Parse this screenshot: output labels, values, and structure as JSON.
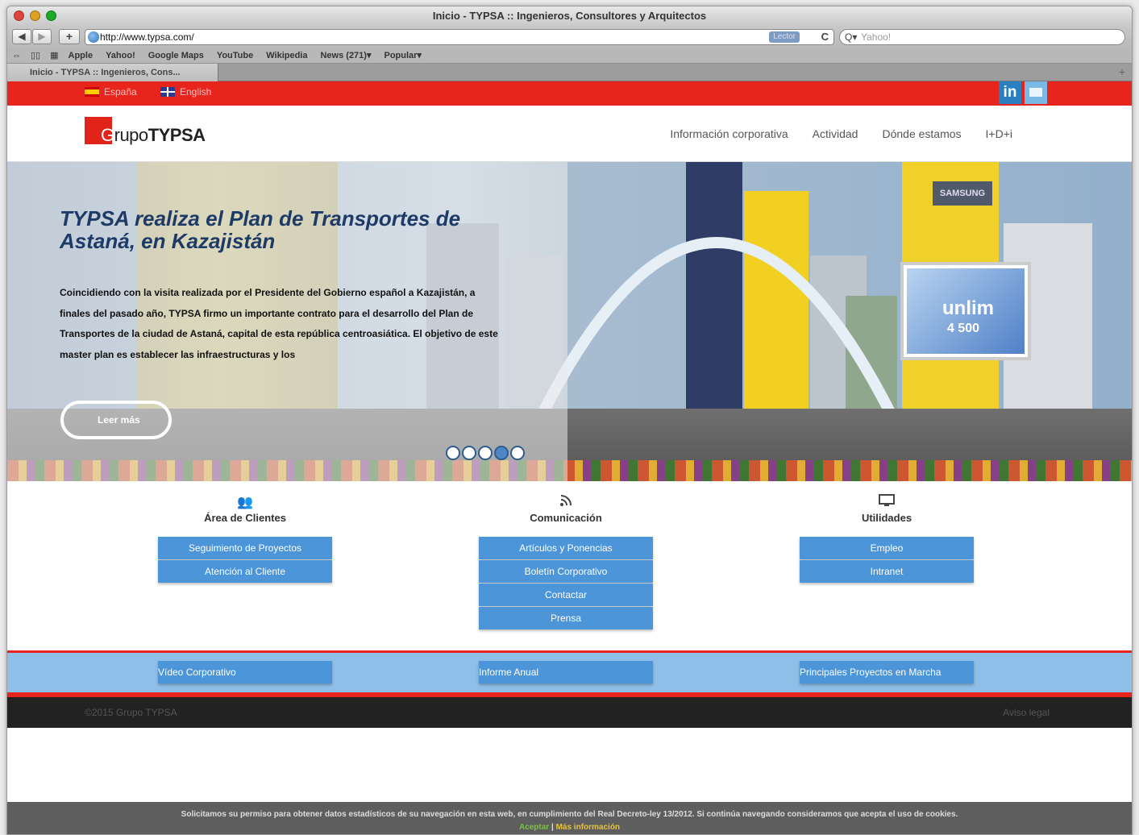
{
  "browser": {
    "window_title": "Inicio - TYPSA :: Ingenieros, Consultores y Arquitectos",
    "url": "http://www.typsa.com/",
    "reader_label": "Lector",
    "search_placeholder": "Yahoo!",
    "bookmarks": [
      "Apple",
      "Yahoo!",
      "Google Maps",
      "YouTube",
      "Wikipedia",
      "News (271)▾",
      "Popular▾"
    ],
    "tab_title": "Inicio - TYPSA :: Ingenieros, Cons..."
  },
  "topbar": {
    "lang_es": "España",
    "lang_en": "English",
    "linkedin_label": "in"
  },
  "header": {
    "logo_prefix": "G",
    "logo_grupo": "rupo",
    "logo_typsa": "TYPSA",
    "nav": [
      "Información corporativa",
      "Actividad",
      "Dónde estamos",
      "I+D+i"
    ]
  },
  "hero": {
    "title": "TYPSA realiza el Plan de Transportes de Astaná, en Kazajistán",
    "text": "Coincidiendo con la visita realizada por el Presidente del Gobierno español a Kazajistán, a finales del pasado año, TYPSA firmo un importante contrato para el desarrollo del Plan de Transportes de la ciudad de Astaná, capital de esta república centroasiática. El objetivo de este master plan  es establecer las infraestructuras y los",
    "read_more": "Leer más",
    "billboard_text": "unlim",
    "billboard_number": "4 500",
    "sign_text": "SAMSUNG",
    "slide_count": 5,
    "active_slide": 4
  },
  "services": [
    {
      "icon": "users-icon",
      "title": "Área de Clientes",
      "buttons": [
        "Seguimiento de Proyectos",
        "Atención al Cliente"
      ]
    },
    {
      "icon": "rss-icon",
      "title": "Comunicación",
      "buttons": [
        "Artículos y Ponencias",
        "Boletín Corporativo",
        "Contactar",
        "Prensa"
      ]
    },
    {
      "icon": "monitor-icon",
      "title": "Utilidades",
      "buttons": [
        "Empleo",
        "Intranet"
      ]
    }
  ],
  "band": [
    "Vídeo Corporativo",
    "Informe Anual",
    "Principales Proyectos en Marcha"
  ],
  "footer": {
    "copyright": "©2015 Grupo TYPSA",
    "legal": "Aviso legal"
  },
  "cookie": {
    "text": "Solicitamos su permiso para obtener datos estadísticos de su navegación en esta web, en cumplimiento del Real Decreto-ley 13/2012. Si continúa navegando consideramos que acepta el uso de cookies.",
    "accept": "Aceptar",
    "separator": "|",
    "more": "Más información"
  },
  "colors": {
    "brand_red": "#e8251c",
    "button_blue": "#4c95d8",
    "band_blue": "#8ebfe8",
    "title_blue": "#1e3a66"
  }
}
